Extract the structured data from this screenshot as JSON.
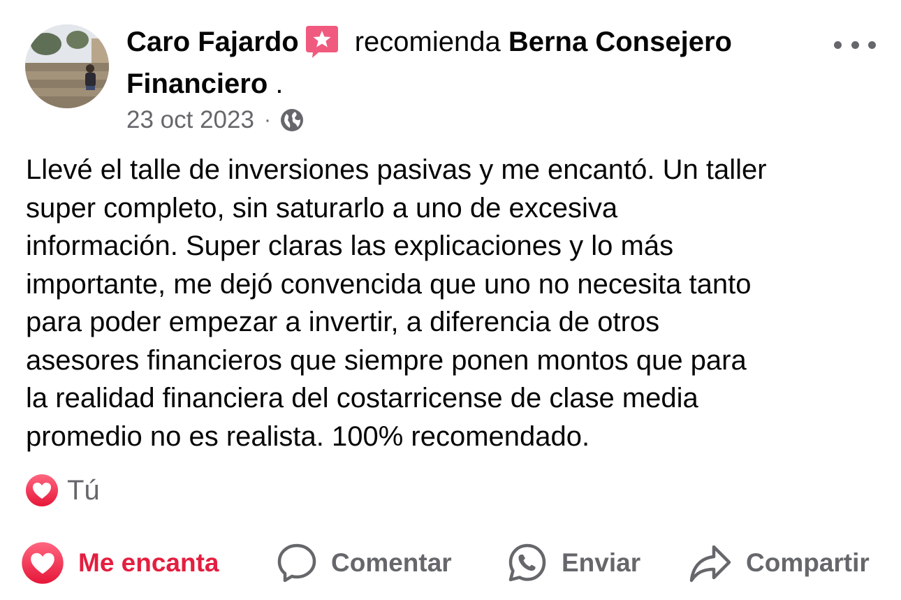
{
  "post": {
    "author_name": "Caro Fajardo",
    "recommends_word": "recomienda",
    "page_name": "Berna Consejero Financiero",
    "trailing_dot": " .",
    "date": "23 oct 2023",
    "separator": "·",
    "audience_icon": "globe-icon",
    "body": "Llevé el talle de inversiones pasivas y me encantó. Un taller\nsuper completo, sin saturarlo a uno de excesiva\ninformación. Super claras las explicaciones y lo más\nimportante, me dejó convencida que uno no necesita tanto\npara poder empezar a invertir, a diferencia de otros\nasesores financieros que siempre ponen montos que para\nla realidad financiera del costarricense de clase media\npromedio no es realista. 100% recomendado."
  },
  "reactions": {
    "icon": "heart-icon",
    "who": "Tú"
  },
  "actions": {
    "love_label": "Me encanta",
    "comment_label": "Comentar",
    "send_label": "Enviar",
    "share_label": "Compartir"
  },
  "colors": {
    "love_red": "#e41e3f",
    "badge_pink": "#f05a7e",
    "secondary_text": "#65676b",
    "primary_text": "#050505"
  }
}
